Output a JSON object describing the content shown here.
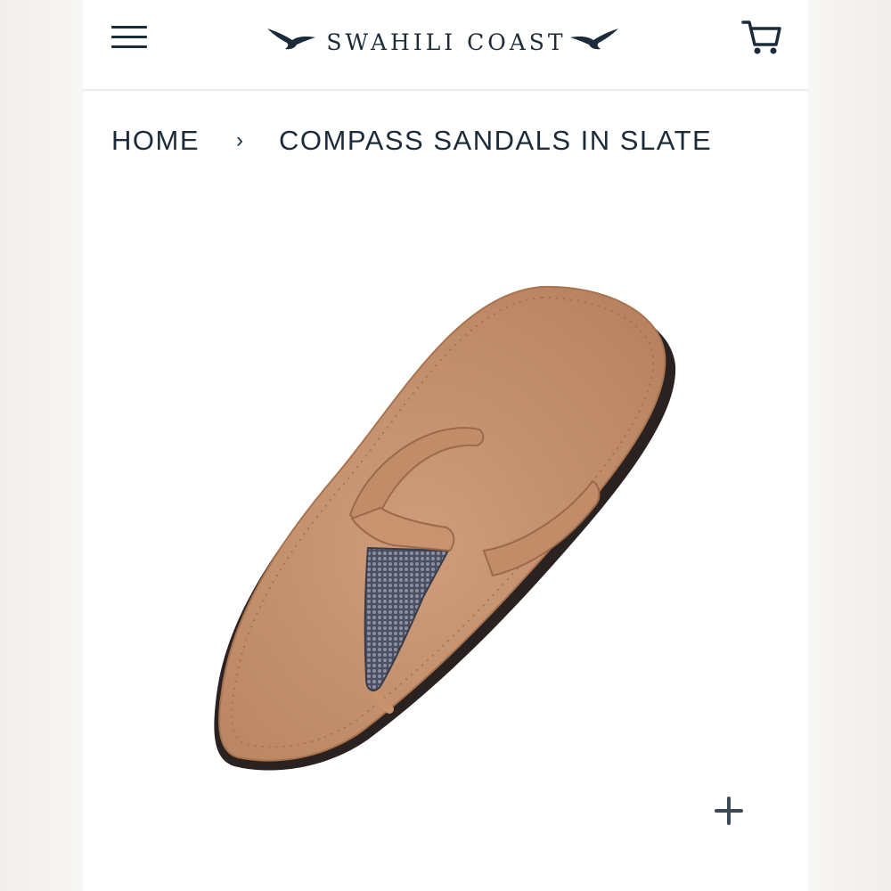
{
  "header": {
    "menu_icon": "hamburger-menu-icon",
    "brand": "SWAHILI COAST",
    "logo_icon": "swallow-bird-icon",
    "cart_icon": "shopping-cart-icon"
  },
  "breadcrumb": {
    "home_label": "HOME",
    "separator": "›",
    "current_label": "COMPASS SANDALS IN SLATE"
  },
  "product": {
    "image_icon": "sandal-product-image"
  },
  "gallery": {
    "zoom_icon": "plus-icon"
  },
  "colors": {
    "text": "#1c2b39",
    "divider": "#e6ecef",
    "leather": "#c4906e",
    "beads": "#5a5e70"
  }
}
